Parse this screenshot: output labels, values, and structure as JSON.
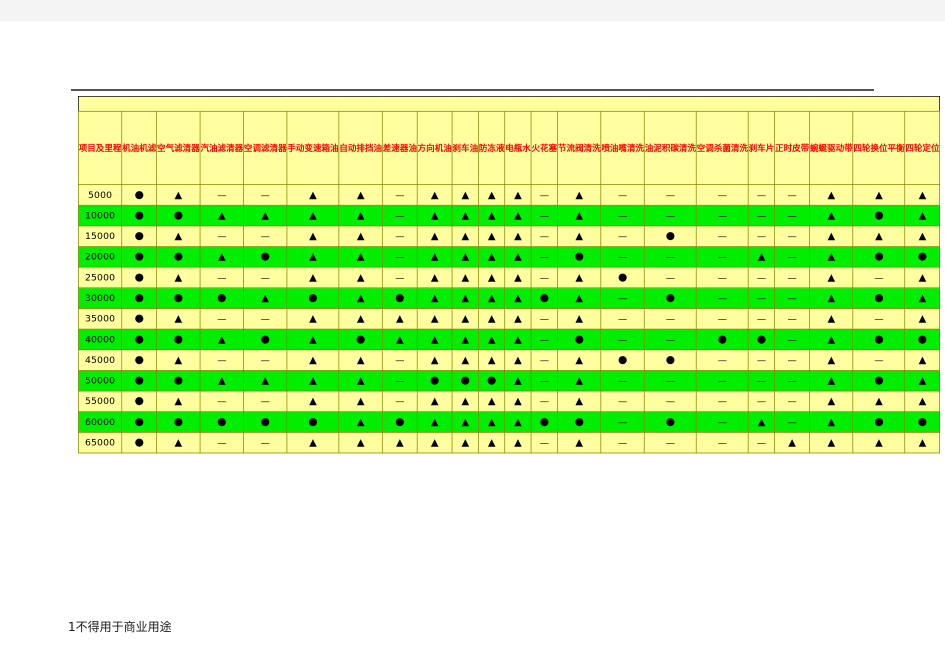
{
  "document": {
    "footer_note": "1不得用于商业用途"
  },
  "colors": {
    "header_text": "#ff0000",
    "cell_yellow": "#ffffa0",
    "cell_green": "#00ee00",
    "grid_line": "#808000",
    "page_background": "#ffffff",
    "app_background": "#f4f4f4"
  },
  "legend": {
    "circle": "●",
    "triangle": "▲",
    "dash": "—"
  },
  "table": {
    "row_header_label": "项目及里程",
    "columns": [
      "机油机滤",
      "空气滤清器",
      "汽油滤清器",
      "空调滤清器",
      "手动变速箱油",
      "自动排挡油",
      "差速器油",
      "方向机油",
      "刹车油",
      "防冻液",
      "电瓶水",
      "火花塞",
      "节流阀清洗",
      "喷油嘴清洗",
      "油泥积碳清洗",
      "空调杀菌清洗",
      "刹车片",
      "正时皮带",
      "蜿蜒驱动带",
      "四轮换位平衡",
      "四轮定位"
    ],
    "rows": [
      {
        "mileage": "5000",
        "shade": "yellow",
        "cells": [
          "●",
          "▲",
          "—",
          "—",
          "▲",
          "▲",
          "—",
          "▲",
          "▲",
          "▲",
          "▲",
          "—",
          "▲",
          "—",
          "—",
          "—",
          "—",
          "—",
          "▲",
          "▲",
          "▲"
        ]
      },
      {
        "mileage": "10000",
        "shade": "green",
        "cells": [
          "●",
          "●",
          "▲",
          "▲",
          "▲",
          "▲",
          "—",
          "▲",
          "▲",
          "▲",
          "▲",
          "—",
          "▲",
          "—",
          "—",
          "—",
          "—",
          "—",
          "▲",
          "●",
          "▲"
        ]
      },
      {
        "mileage": "15000",
        "shade": "yellow",
        "cells": [
          "●",
          "▲",
          "—",
          "—",
          "▲",
          "▲",
          "—",
          "▲",
          "▲",
          "▲",
          "▲",
          "—",
          "▲",
          "—",
          "●",
          "—",
          "—",
          "—",
          "▲",
          "▲",
          "▲"
        ]
      },
      {
        "mileage": "20000",
        "shade": "green",
        "cells": [
          "●",
          "●",
          "▲",
          "●",
          "▲",
          "▲",
          "—",
          "▲",
          "▲",
          "▲",
          "▲",
          "—",
          "●",
          "—",
          "—",
          "—",
          "▲",
          "—",
          "▲",
          "●",
          "●"
        ]
      },
      {
        "mileage": "25000",
        "shade": "yellow",
        "cells": [
          "●",
          "▲",
          "—",
          "—",
          "▲",
          "▲",
          "—",
          "▲",
          "▲",
          "▲",
          "▲",
          "—",
          "▲",
          "●",
          "—",
          "—",
          "—",
          "—",
          "▲",
          "—",
          "▲"
        ]
      },
      {
        "mileage": "30000",
        "shade": "green",
        "cells": [
          "●",
          "●",
          "●",
          "▲",
          "●",
          "▲",
          "●",
          "▲",
          "▲",
          "▲",
          "▲",
          "●",
          "▲",
          "—",
          "●",
          "—",
          "—",
          "—",
          "▲",
          "●",
          "▲"
        ]
      },
      {
        "mileage": "35000",
        "shade": "yellow",
        "cells": [
          "●",
          "▲",
          "—",
          "—",
          "▲",
          "▲",
          "▲",
          "▲",
          "▲",
          "▲",
          "▲",
          "—",
          "▲",
          "—",
          "—",
          "—",
          "—",
          "—",
          "▲",
          "—",
          "▲"
        ]
      },
      {
        "mileage": "40000",
        "shade": "green",
        "cells": [
          "●",
          "●",
          "▲",
          "●",
          "▲",
          "●",
          "▲",
          "▲",
          "▲",
          "▲",
          "▲",
          "—",
          "●",
          "—",
          "—",
          "●",
          "●",
          "—",
          "▲",
          "●",
          "●"
        ]
      },
      {
        "mileage": "45000",
        "shade": "yellow",
        "cells": [
          "●",
          "▲",
          "—",
          "—",
          "▲",
          "▲",
          "—",
          "▲",
          "▲",
          "▲",
          "▲",
          "—",
          "▲",
          "●",
          "●",
          "—",
          "—",
          "—",
          "▲",
          "—",
          "▲"
        ]
      },
      {
        "mileage": "50000",
        "shade": "green",
        "cells": [
          "●",
          "●",
          "▲",
          "▲",
          "▲",
          "▲",
          "—",
          "●",
          "●",
          "●",
          "▲",
          "—",
          "▲",
          "—",
          "—",
          "—",
          "—",
          "—",
          "▲",
          "●",
          "▲"
        ]
      },
      {
        "mileage": "55000",
        "shade": "yellow",
        "cells": [
          "●",
          "▲",
          "—",
          "—",
          "▲",
          "▲",
          "—",
          "▲",
          "▲",
          "▲",
          "▲",
          "—",
          "▲",
          "—",
          "—",
          "—",
          "—",
          "—",
          "▲",
          "▲",
          "▲"
        ]
      },
      {
        "mileage": "60000",
        "shade": "green",
        "cells": [
          "●",
          "●",
          "●",
          "●",
          "●",
          "▲",
          "●",
          "▲",
          "▲",
          "▲",
          "▲",
          "●",
          "●",
          "—",
          "●",
          "—",
          "▲",
          "—",
          "▲",
          "●",
          "●"
        ]
      },
      {
        "mileage": "65000",
        "shade": "yellow",
        "cells": [
          "●",
          "▲",
          "—",
          "—",
          "▲",
          "▲",
          "▲",
          "▲",
          "▲",
          "▲",
          "▲",
          "—",
          "▲",
          "—",
          "—",
          "—",
          "—",
          "▲",
          "▲",
          "▲",
          "▲"
        ]
      }
    ]
  }
}
